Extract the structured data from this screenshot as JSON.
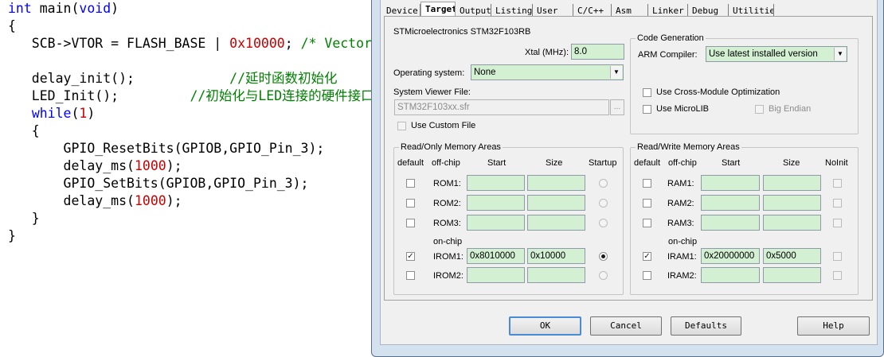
{
  "editor": {
    "lines": [
      {
        "parts": [
          {
            "t": "int",
            "c": "kw"
          },
          {
            "t": " main("
          },
          {
            "t": "void",
            "c": "kw"
          },
          {
            "t": ")"
          }
        ]
      },
      {
        "parts": [
          {
            "t": "{"
          }
        ]
      },
      {
        "parts": [
          {
            "t": "   SCB->VTOR = FLASH_BASE | "
          },
          {
            "t": "0x10000",
            "c": "num"
          },
          {
            "t": "; "
          },
          {
            "t": "/* Vector Table Relocation in Internal FLASH. */",
            "c": "cmt"
          }
        ]
      },
      {
        "parts": [
          {
            "t": ""
          }
        ]
      },
      {
        "parts": [
          {
            "t": "   delay_init();            "
          },
          {
            "t": "//延时函数初始化",
            "c": "cmt"
          }
        ]
      },
      {
        "parts": [
          {
            "t": "   LED_Init();         "
          },
          {
            "t": "//初始化与LED连接的硬件接口",
            "c": "cmt"
          }
        ]
      },
      {
        "parts": [
          {
            "t": "   "
          },
          {
            "t": "while",
            "c": "kw"
          },
          {
            "t": "("
          },
          {
            "t": "1",
            "c": "num"
          },
          {
            "t": ")"
          }
        ]
      },
      {
        "parts": [
          {
            "t": "   {"
          }
        ]
      },
      {
        "parts": [
          {
            "t": "       GPIO_ResetBits(GPIOB,GPIO_Pin_3);"
          }
        ]
      },
      {
        "parts": [
          {
            "t": "       delay_ms("
          },
          {
            "t": "1000",
            "c": "num"
          },
          {
            "t": ");"
          }
        ]
      },
      {
        "parts": [
          {
            "t": "       GPIO_SetBits(GPIOB,GPIO_Pin_3);"
          }
        ]
      },
      {
        "parts": [
          {
            "t": "       delay_ms("
          },
          {
            "t": "1000",
            "c": "num"
          },
          {
            "t": ");"
          }
        ]
      },
      {
        "parts": [
          {
            "t": "   }"
          }
        ]
      },
      {
        "parts": [
          {
            "t": "}"
          }
        ]
      }
    ]
  },
  "dialog": {
    "tabs": [
      "Device",
      "Target",
      "Output",
      "Listing",
      "User",
      "C/C++",
      "Asm",
      "Linker",
      "Debug",
      "Utilities"
    ],
    "active_tab": "Target",
    "device_name": "STMicroelectronics STM32F103RB",
    "xtal_label": "Xtal (MHz):",
    "xtal_value": "8.0",
    "os_label": "Operating system:",
    "os_value": "None",
    "svf_label": "System Viewer File:",
    "svf_value": "STM32F103xx.sfr",
    "browse_label": "...",
    "custom_file_label": "Use Custom File",
    "code_gen": {
      "title": "Code Generation",
      "compiler_label": "ARM Compiler:",
      "compiler_value": "Use latest installed version",
      "cross_module_label": "Use Cross-Module Optimization",
      "microlib_label": "Use MicroLIB",
      "big_endian_label": "Big Endian"
    },
    "ro_mem": {
      "title": "Read/Only Memory Areas",
      "headers": {
        "default": "default",
        "offchip": "off-chip",
        "start": "Start",
        "size": "Size",
        "startup": "Startup"
      },
      "onchip_label": "on-chip",
      "rows": [
        {
          "label": "ROM1:",
          "start": "",
          "size": "",
          "default": false,
          "startup": false
        },
        {
          "label": "ROM2:",
          "start": "",
          "size": "",
          "default": false,
          "startup": false
        },
        {
          "label": "ROM3:",
          "start": "",
          "size": "",
          "default": false,
          "startup": false
        },
        {
          "label": "IROM1:",
          "start": "0x8010000",
          "size": "0x10000",
          "default": true,
          "startup": true
        },
        {
          "label": "IROM2:",
          "start": "",
          "size": "",
          "default": false,
          "startup": false
        }
      ]
    },
    "rw_mem": {
      "title": "Read/Write Memory Areas",
      "headers": {
        "default": "default",
        "offchip": "off-chip",
        "start": "Start",
        "size": "Size",
        "noinit": "NoInit"
      },
      "onchip_label": "on-chip",
      "rows": [
        {
          "label": "RAM1:",
          "start": "",
          "size": "",
          "default": false,
          "noinit": false
        },
        {
          "label": "RAM2:",
          "start": "",
          "size": "",
          "default": false,
          "noinit": false
        },
        {
          "label": "RAM3:",
          "start": "",
          "size": "",
          "default": false,
          "noinit": false
        },
        {
          "label": "IRAM1:",
          "start": "0x20000000",
          "size": "0x5000",
          "default": true,
          "noinit": false
        },
        {
          "label": "IRAM2:",
          "start": "",
          "size": "",
          "default": false,
          "noinit": false
        }
      ]
    },
    "buttons": {
      "ok": "OK",
      "cancel": "Cancel",
      "defaults": "Defaults",
      "help": "Help"
    }
  }
}
